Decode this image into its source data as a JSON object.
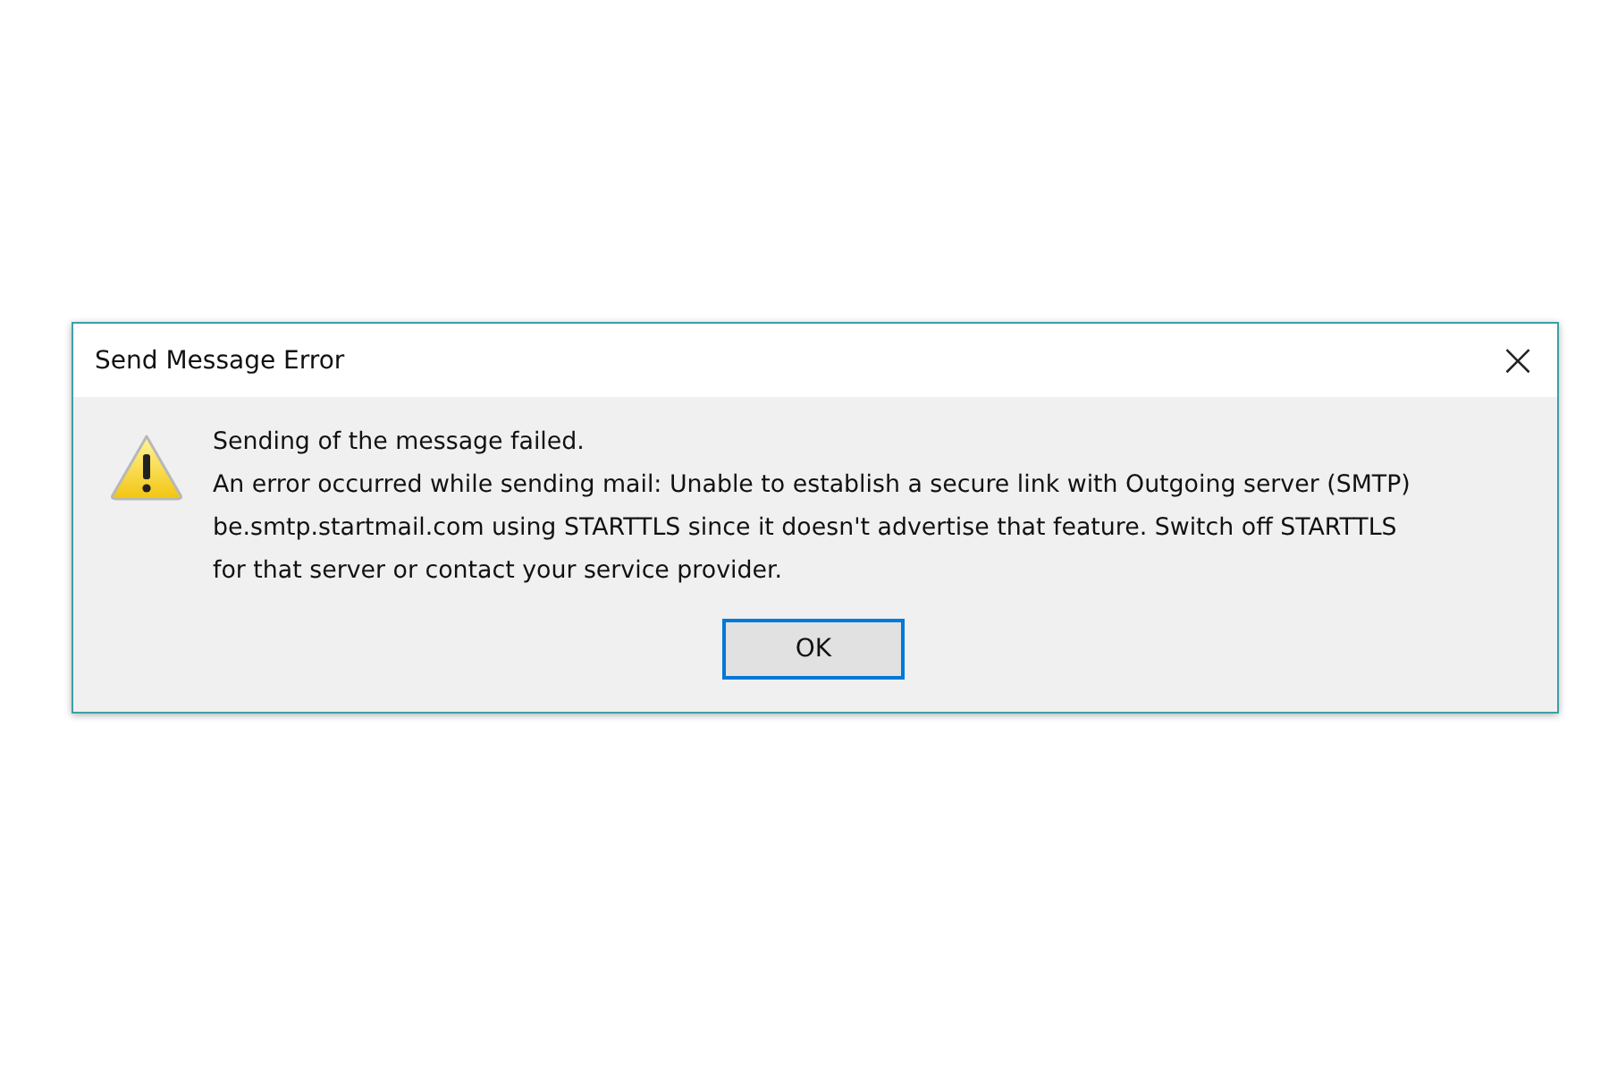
{
  "dialog": {
    "title": "Send Message Error",
    "close_glyph": "×",
    "heading": "Sending of the message failed.",
    "detail_lines": [
      "An error occurred while sending mail: Unable to establish a secure link with Outgoing server (SMTP)",
      "be.smtp.startmail.com using STARTTLS since it doesn't advertise that feature. Switch off STARTTLS",
      "for that server or contact your service provider."
    ],
    "buttons": [
      {
        "label": "OK",
        "default": true
      }
    ]
  }
}
